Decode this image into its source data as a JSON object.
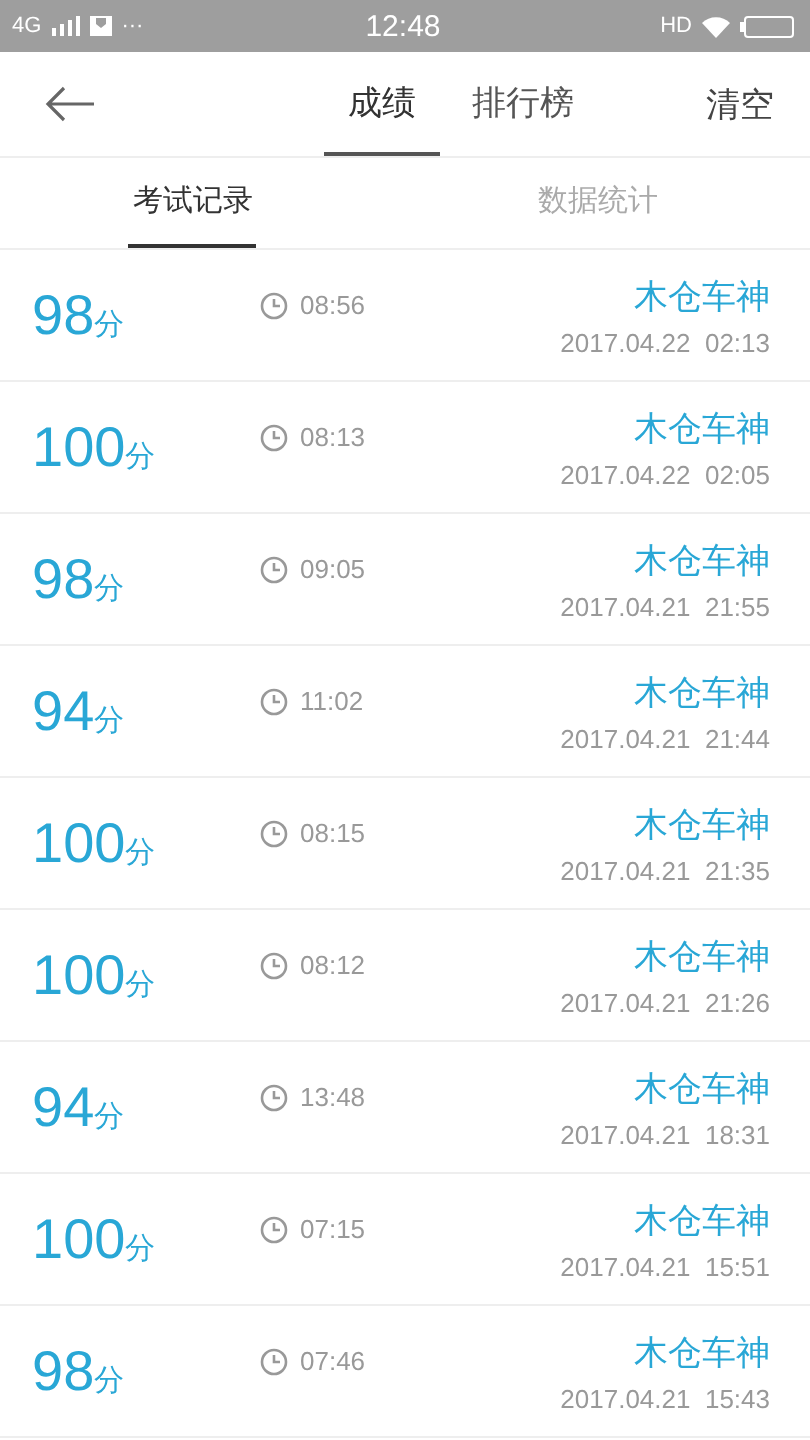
{
  "status_bar": {
    "network": "4G",
    "more": "···",
    "time": "12:48",
    "hd": "HD"
  },
  "header": {
    "tabs": [
      {
        "label": "成绩",
        "selected": true
      },
      {
        "label": "排行榜",
        "selected": false
      }
    ],
    "action": "清空"
  },
  "sub_tabs": [
    {
      "label": "考试记录",
      "selected": true
    },
    {
      "label": "数据统计",
      "selected": false
    }
  ],
  "records": [
    {
      "score": "98",
      "unit": "分",
      "duration": "08:56",
      "name": "木仓车神",
      "date": "2017.04.22  02:13"
    },
    {
      "score": "100",
      "unit": "分",
      "duration": "08:13",
      "name": "木仓车神",
      "date": "2017.04.22  02:05"
    },
    {
      "score": "98",
      "unit": "分",
      "duration": "09:05",
      "name": "木仓车神",
      "date": "2017.04.21  21:55"
    },
    {
      "score": "94",
      "unit": "分",
      "duration": "11:02",
      "name": "木仓车神",
      "date": "2017.04.21  21:44"
    },
    {
      "score": "100",
      "unit": "分",
      "duration": "08:15",
      "name": "木仓车神",
      "date": "2017.04.21  21:35"
    },
    {
      "score": "100",
      "unit": "分",
      "duration": "08:12",
      "name": "木仓车神",
      "date": "2017.04.21  21:26"
    },
    {
      "score": "94",
      "unit": "分",
      "duration": "13:48",
      "name": "木仓车神",
      "date": "2017.04.21  18:31"
    },
    {
      "score": "100",
      "unit": "分",
      "duration": "07:15",
      "name": "木仓车神",
      "date": "2017.04.21  15:51"
    },
    {
      "score": "98",
      "unit": "分",
      "duration": "07:46",
      "name": "木仓车神",
      "date": "2017.04.21  15:43"
    }
  ]
}
